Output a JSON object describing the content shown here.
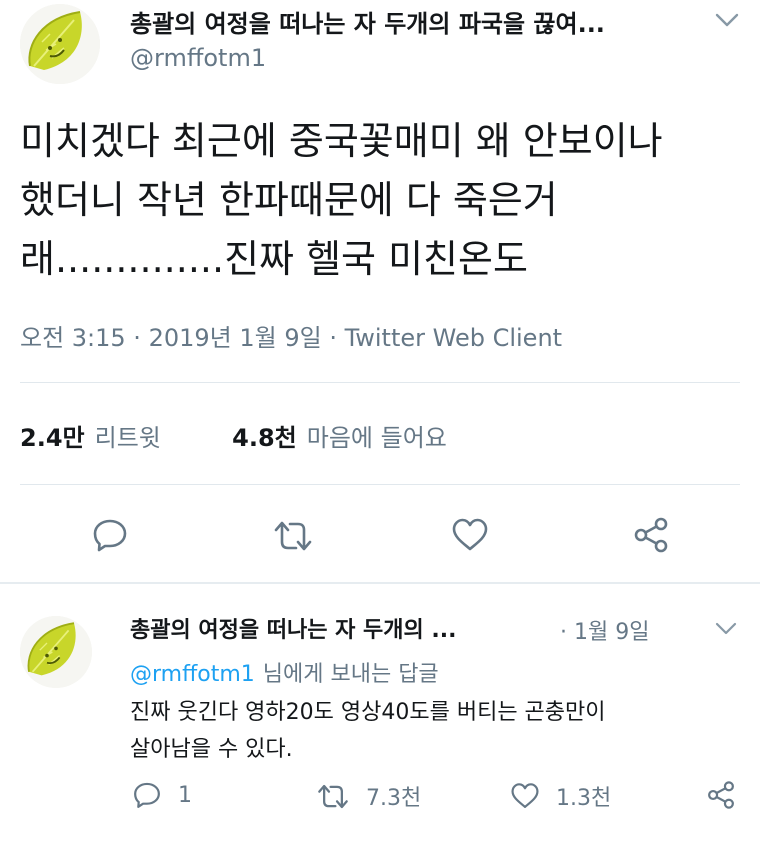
{
  "main_tweet": {
    "author_name": "총괄의 여정을 떠나는 자 두개의 파국을 끊여...",
    "author_handle": "@rmffotm1",
    "avatar_icon": "leaf-avatar-icon",
    "menu_icon": "chevron-down-icon",
    "text": "미치겠다 최근에 중국꽃매미 왜 안보이나\n했더니 작년 한파때문에 다 죽은거\n래..............진짜 헬국 미친온도",
    "meta": "오전 3:15 · 2019년 1월 9일 · Twitter Web Client",
    "retweets_count": "2.4만",
    "retweets_label": "리트윗",
    "likes_count": "4.8천",
    "likes_label": "마음에 들어요",
    "actions": [
      "reply-icon",
      "retweet-icon",
      "like-icon",
      "share-icon"
    ]
  },
  "reply_tweet": {
    "author_name": "총괄의 여정을 떠나는 자 두개의 ...",
    "date": "· 1월 9일",
    "reply_to_handle": "@rmffotm1",
    "reply_to_suffix": "님에게 보내는 답글",
    "text": "진짜 웃긴다 영하20도 영상40도를 버티는 곤충만이\n살아남을 수 있다.",
    "reply_count": "1",
    "retweet_count": "7.3천",
    "like_count": "1.3천"
  },
  "colors": {
    "text": "#14171a",
    "secondary": "#657786",
    "link": "#1da1f2",
    "divider": "#e1e8ed",
    "leaf_green": "#c8d62a"
  }
}
